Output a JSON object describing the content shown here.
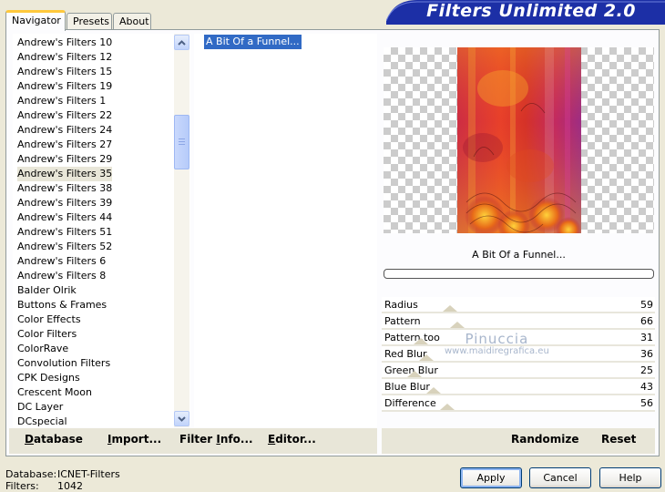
{
  "header": {
    "title": "Filters Unlimited 2.0"
  },
  "tabs": [
    {
      "label": "Navigator"
    },
    {
      "label": "Presets"
    },
    {
      "label": "About"
    }
  ],
  "categories": [
    "Andrew's Filters 10",
    "Andrew's Filters 12",
    "Andrew's Filters 15",
    "Andrew's Filters 19",
    "Andrew's Filters 1",
    "Andrew's Filters 22",
    "Andrew's Filters 24",
    "Andrew's Filters 27",
    "Andrew's Filters 29",
    "Andrew's Filters 35",
    "Andrew's Filters 38",
    "Andrew's Filters 39",
    "Andrew's Filters 44",
    "Andrew's Filters 51",
    "Andrew's Filters 52",
    "Andrew's Filters 6",
    "Andrew's Filters 8",
    "Balder Olrik",
    "Buttons & Frames",
    "Color Effects",
    "Color Filters",
    "ColorRave",
    "Convolution Filters",
    "CPK Designs",
    "Crescent Moon",
    "DC Layer",
    "DCspecial"
  ],
  "selected_category": "Andrew's Filters 35",
  "filters": [
    "A Bit Of a Funnel..."
  ],
  "preview": {
    "effect_name": "A Bit Of a Funnel..."
  },
  "sliders": [
    {
      "label": "Radius",
      "value": 59
    },
    {
      "label": "Pattern",
      "value": 66
    },
    {
      "label": "Pattern,too",
      "value": 31
    },
    {
      "label": "Red Blur",
      "value": 36
    },
    {
      "label": "Green Blur",
      "value": 25
    },
    {
      "label": "Blue Blur",
      "value": 43
    },
    {
      "label": "Difference",
      "value": 56
    }
  ],
  "watermark": {
    "name": "Pinuccia",
    "url": "www.maidiregrafica.eu"
  },
  "toolbar": {
    "database": {
      "u": "D",
      "rest": "atabase"
    },
    "import": {
      "u": "I",
      "rest": "mport..."
    },
    "filter_info": {
      "pre": "Filter ",
      "u": "I",
      "rest": "nfo..."
    },
    "editor": {
      "u": "E",
      "rest": "ditor..."
    },
    "randomize": "Randomize",
    "reset": "Reset"
  },
  "info": {
    "database_label": "Database:",
    "database_value": "ICNET-Filters",
    "filters_label": "Filters:",
    "filters_value": "1042"
  },
  "buttons": {
    "apply": "Apply",
    "cancel": "Cancel",
    "help": "Help"
  },
  "colors": {
    "accent": "#316ac5",
    "title_bg": "#0a1f9c",
    "tab_highlight": "#ffc83c"
  }
}
